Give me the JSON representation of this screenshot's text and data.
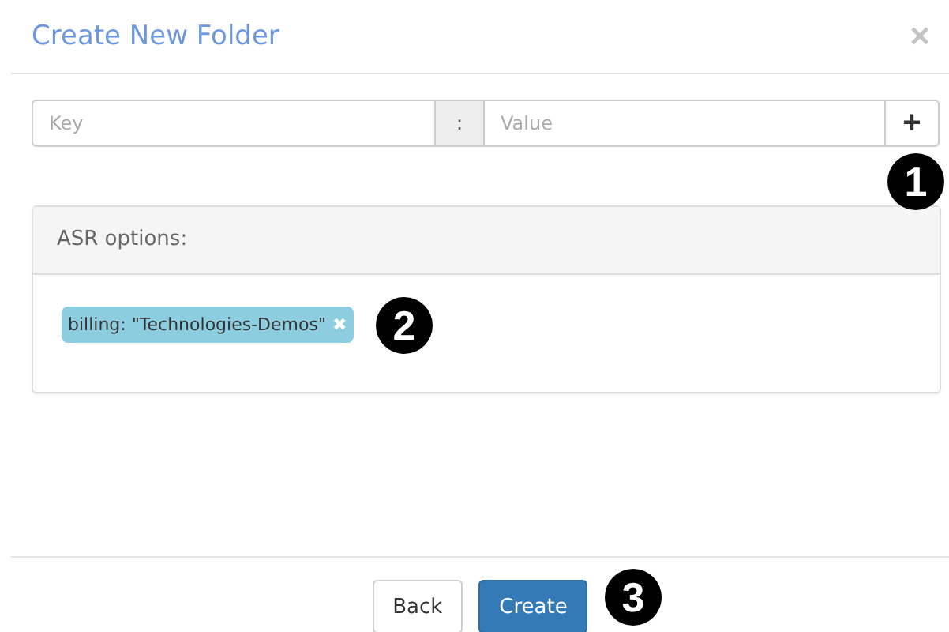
{
  "dialog": {
    "title": "Create New Folder",
    "close": "×"
  },
  "key_value_input": {
    "key_placeholder": "Key",
    "separator": ":",
    "value_placeholder": "Value",
    "add_button": "+"
  },
  "options_panel": {
    "heading": "ASR options:",
    "tags": [
      {
        "label": "billing: \"Technologies-Demos\"",
        "remove": "✖"
      }
    ]
  },
  "footer": {
    "buttons": [
      {
        "label": "Back",
        "kind": "default"
      },
      {
        "label": "Create",
        "kind": "primary"
      }
    ]
  },
  "callouts": [
    {
      "number": "1"
    },
    {
      "number": "2"
    },
    {
      "number": "3"
    }
  ]
}
